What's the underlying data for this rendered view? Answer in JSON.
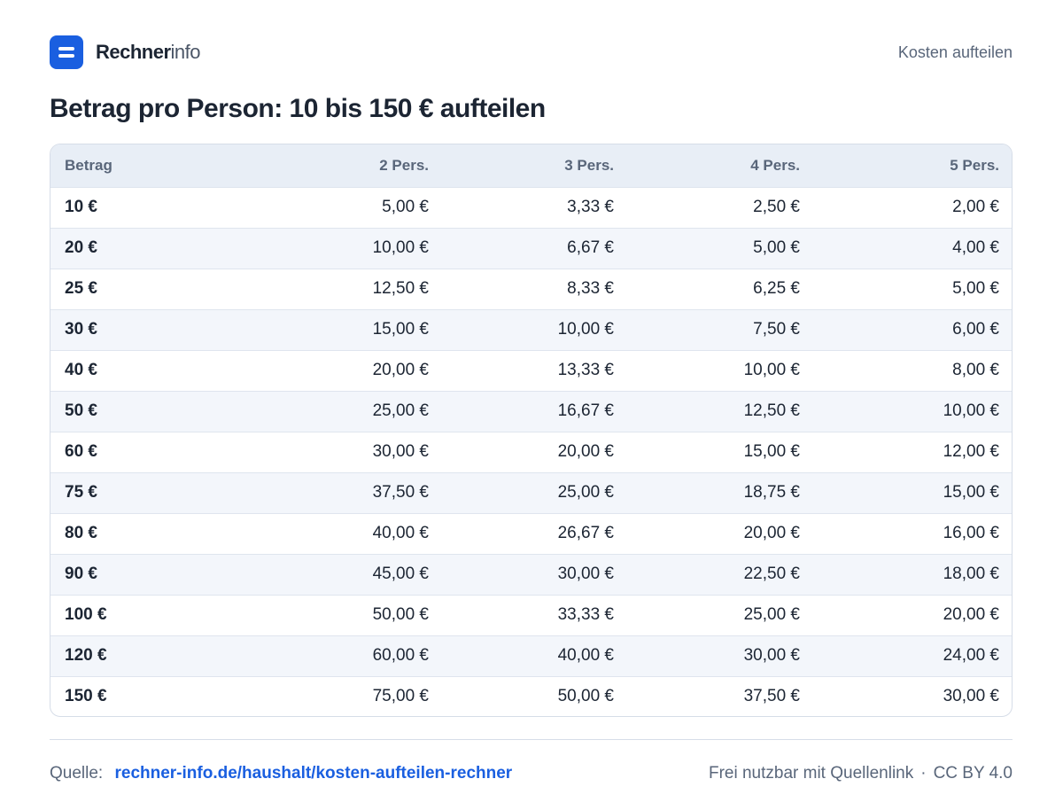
{
  "brand": {
    "name_bold": "Rechner",
    "name_light": "info"
  },
  "header": {
    "link": "Kosten aufteilen"
  },
  "title": "Betrag pro Person: 10 bis 150 € aufteilen",
  "table": {
    "headers": [
      "Betrag",
      "2 Pers.",
      "3 Pers.",
      "4 Pers.",
      "5 Pers."
    ],
    "rows": [
      [
        "10 €",
        "5,00 €",
        "3,33 €",
        "2,50 €",
        "2,00 €"
      ],
      [
        "20 €",
        "10,00 €",
        "6,67 €",
        "5,00 €",
        "4,00 €"
      ],
      [
        "25 €",
        "12,50 €",
        "8,33 €",
        "6,25 €",
        "5,00 €"
      ],
      [
        "30 €",
        "15,00 €",
        "10,00 €",
        "7,50 €",
        "6,00 €"
      ],
      [
        "40 €",
        "20,00 €",
        "13,33 €",
        "10,00 €",
        "8,00 €"
      ],
      [
        "50 €",
        "25,00 €",
        "16,67 €",
        "12,50 €",
        "10,00 €"
      ],
      [
        "60 €",
        "30,00 €",
        "20,00 €",
        "15,00 €",
        "12,00 €"
      ],
      [
        "75 €",
        "37,50 €",
        "25,00 €",
        "18,75 €",
        "15,00 €"
      ],
      [
        "80 €",
        "40,00 €",
        "26,67 €",
        "20,00 €",
        "16,00 €"
      ],
      [
        "90 €",
        "45,00 €",
        "30,00 €",
        "22,50 €",
        "18,00 €"
      ],
      [
        "100 €",
        "50,00 €",
        "33,33 €",
        "25,00 €",
        "20,00 €"
      ],
      [
        "120 €",
        "60,00 €",
        "40,00 €",
        "30,00 €",
        "24,00 €"
      ],
      [
        "150 €",
        "75,00 €",
        "50,00 €",
        "37,50 €",
        "30,00 €"
      ]
    ]
  },
  "footer": {
    "source_label": "Quelle:",
    "source_link": "rechner-info.de/haushalt/kosten-aufteilen-rechner",
    "license_note": "Frei nutzbar mit Quellenlink",
    "separator": "·",
    "license": "CC BY 4.0"
  },
  "colors": {
    "accent": "#1a5fe0",
    "text": "#1c2533",
    "muted": "#59667a",
    "header_bg": "#e8eef6",
    "stripe": "#f3f6fb"
  }
}
